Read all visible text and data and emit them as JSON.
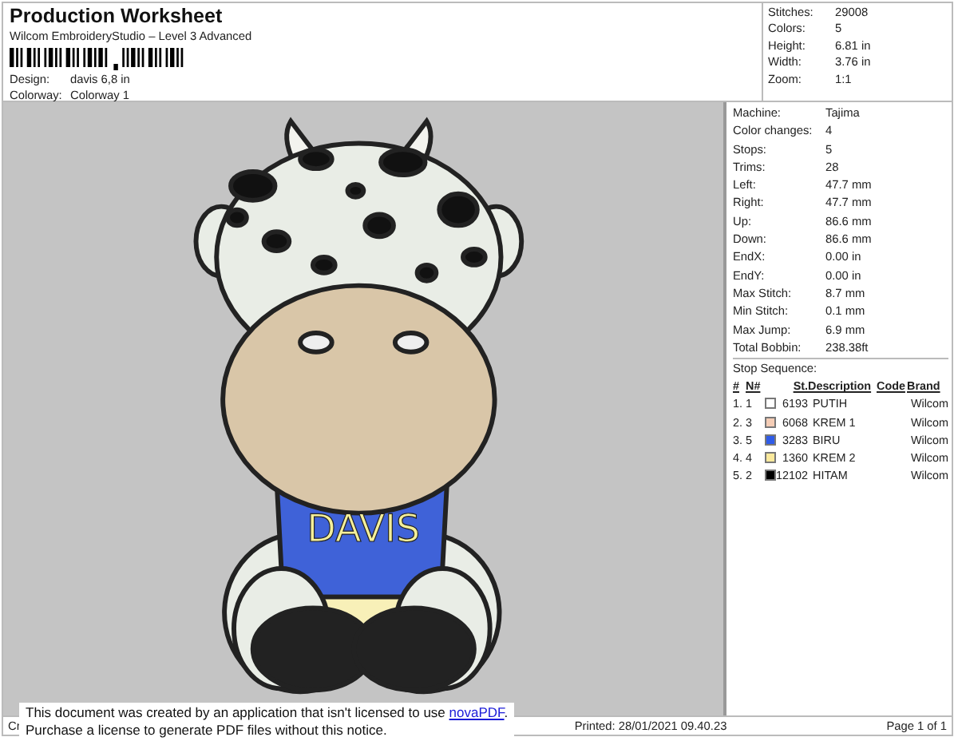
{
  "header": {
    "title": "Production Worksheet",
    "subtitle": "Wilcom EmbroideryStudio – Level 3 Advanced",
    "fields": [
      {
        "label": "Design:",
        "value": "davis 6,8 in"
      },
      {
        "label": "Colorway:",
        "value": "Colorway 1"
      }
    ]
  },
  "summary": [
    {
      "label": "Stitches:",
      "value": "29008"
    },
    {
      "label": "Colors:",
      "value": "5"
    },
    {
      "label": "Height:",
      "value": "6.81 in"
    },
    {
      "label": "Width:",
      "value": "3.76 in"
    },
    {
      "label": "Zoom:",
      "value": "1:1"
    }
  ],
  "design": {
    "lettering": "DAVIS"
  },
  "machine_info": [
    {
      "label": "Machine:",
      "value": "Tajima"
    },
    {
      "label": "Color changes:",
      "value": "4"
    },
    {
      "label": "Stops:",
      "value": "5"
    },
    {
      "label": "Trims:",
      "value": "28"
    },
    {
      "label": "Left:",
      "value": "47.7 mm"
    },
    {
      "label": "Right:",
      "value": "47.7 mm"
    },
    {
      "label": "Up:",
      "value": "86.6 mm"
    },
    {
      "label": "Down:",
      "value": "86.6 mm"
    },
    {
      "label": "EndX:",
      "value": "0.00 in"
    },
    {
      "label": "EndY:",
      "value": "0.00 in"
    },
    {
      "label": "Max Stitch:",
      "value": "8.7 mm"
    },
    {
      "label": "Min Stitch:",
      "value": "0.1 mm"
    },
    {
      "label": "Max Jump:",
      "value": "6.9 mm"
    },
    {
      "label": "Total Bobbin:",
      "value": "238.38ft"
    }
  ],
  "stop_sequence": {
    "title": "Stop Sequence:",
    "columns": [
      "#",
      "N#",
      "St.",
      "Description",
      "Code",
      "Brand"
    ],
    "rows": [
      {
        "index": "1.",
        "number": "1",
        "color": "#ffffff",
        "stitches": "6193",
        "description": "PUTIH",
        "brand": "Wilcom"
      },
      {
        "index": "2.",
        "number": "3",
        "color": "#f5cdb6",
        "stitches": "6068",
        "description": "KREM 1",
        "brand": "Wilcom"
      },
      {
        "index": "3.",
        "number": "5",
        "color": "#2f5ce8",
        "stitches": "3283",
        "description": "BIRU",
        "brand": "Wilcom"
      },
      {
        "index": "4.",
        "number": "4",
        "color": "#fbe99c",
        "stitches": "1360",
        "description": "KREM 2",
        "brand": "Wilcom"
      },
      {
        "index": "5.",
        "number": "2",
        "color": "#000000",
        "stitches": "12102",
        "description": "HITAM",
        "brand": "Wilcom"
      }
    ]
  },
  "footer": {
    "left": "Cr",
    "printed": "Printed: 28/01/2021 09.40.23",
    "page": "Page 1 of 1"
  },
  "notice": {
    "line1": "This document was created by an application that isn't licensed to use ",
    "link": "novaPDF",
    "line1_end": ".",
    "line2": "Purchase a license to generate PDF files without this notice."
  }
}
